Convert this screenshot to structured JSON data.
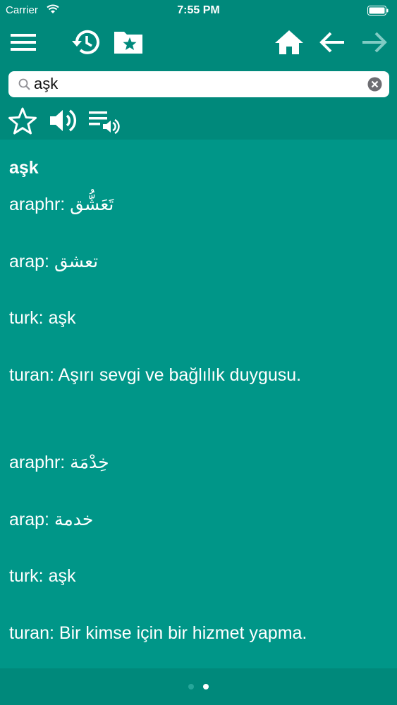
{
  "status_bar": {
    "carrier": "Carrier",
    "time": "7:55 PM"
  },
  "toolbar": {
    "icons": [
      "menu-icon",
      "history-icon",
      "favorites-folder-icon",
      "home-icon",
      "back-arrow-icon",
      "forward-arrow-icon"
    ]
  },
  "search": {
    "value": "aşk"
  },
  "actions": {
    "icons": [
      "star-icon",
      "speaker-icon",
      "playlist-speak-icon"
    ]
  },
  "entry": {
    "title": "aşk",
    "lines": [
      {
        "label": "araphr:",
        "value": "تَعَشُّق"
      },
      {
        "label": "arap:",
        "value": "تعشق"
      },
      {
        "label": "turk:",
        "value": "aşk"
      },
      {
        "label": "turan:",
        "value": "Aşırı sevgi ve bağlılık duygusu."
      },
      {
        "label": "araphr:",
        "value": "خِدْمَة"
      },
      {
        "label": "arap:",
        "value": "خدمة"
      },
      {
        "label": "turk:",
        "value": "aşk"
      },
      {
        "label": "turan:",
        "value": "Bir kimse için bir hizmet yapma."
      }
    ]
  },
  "pager": {
    "pages": 2,
    "current": 2
  },
  "colors": {
    "header": "#00897b",
    "content": "#009688",
    "text": "#ffffff",
    "forward_disabled": "#80cbc4"
  }
}
